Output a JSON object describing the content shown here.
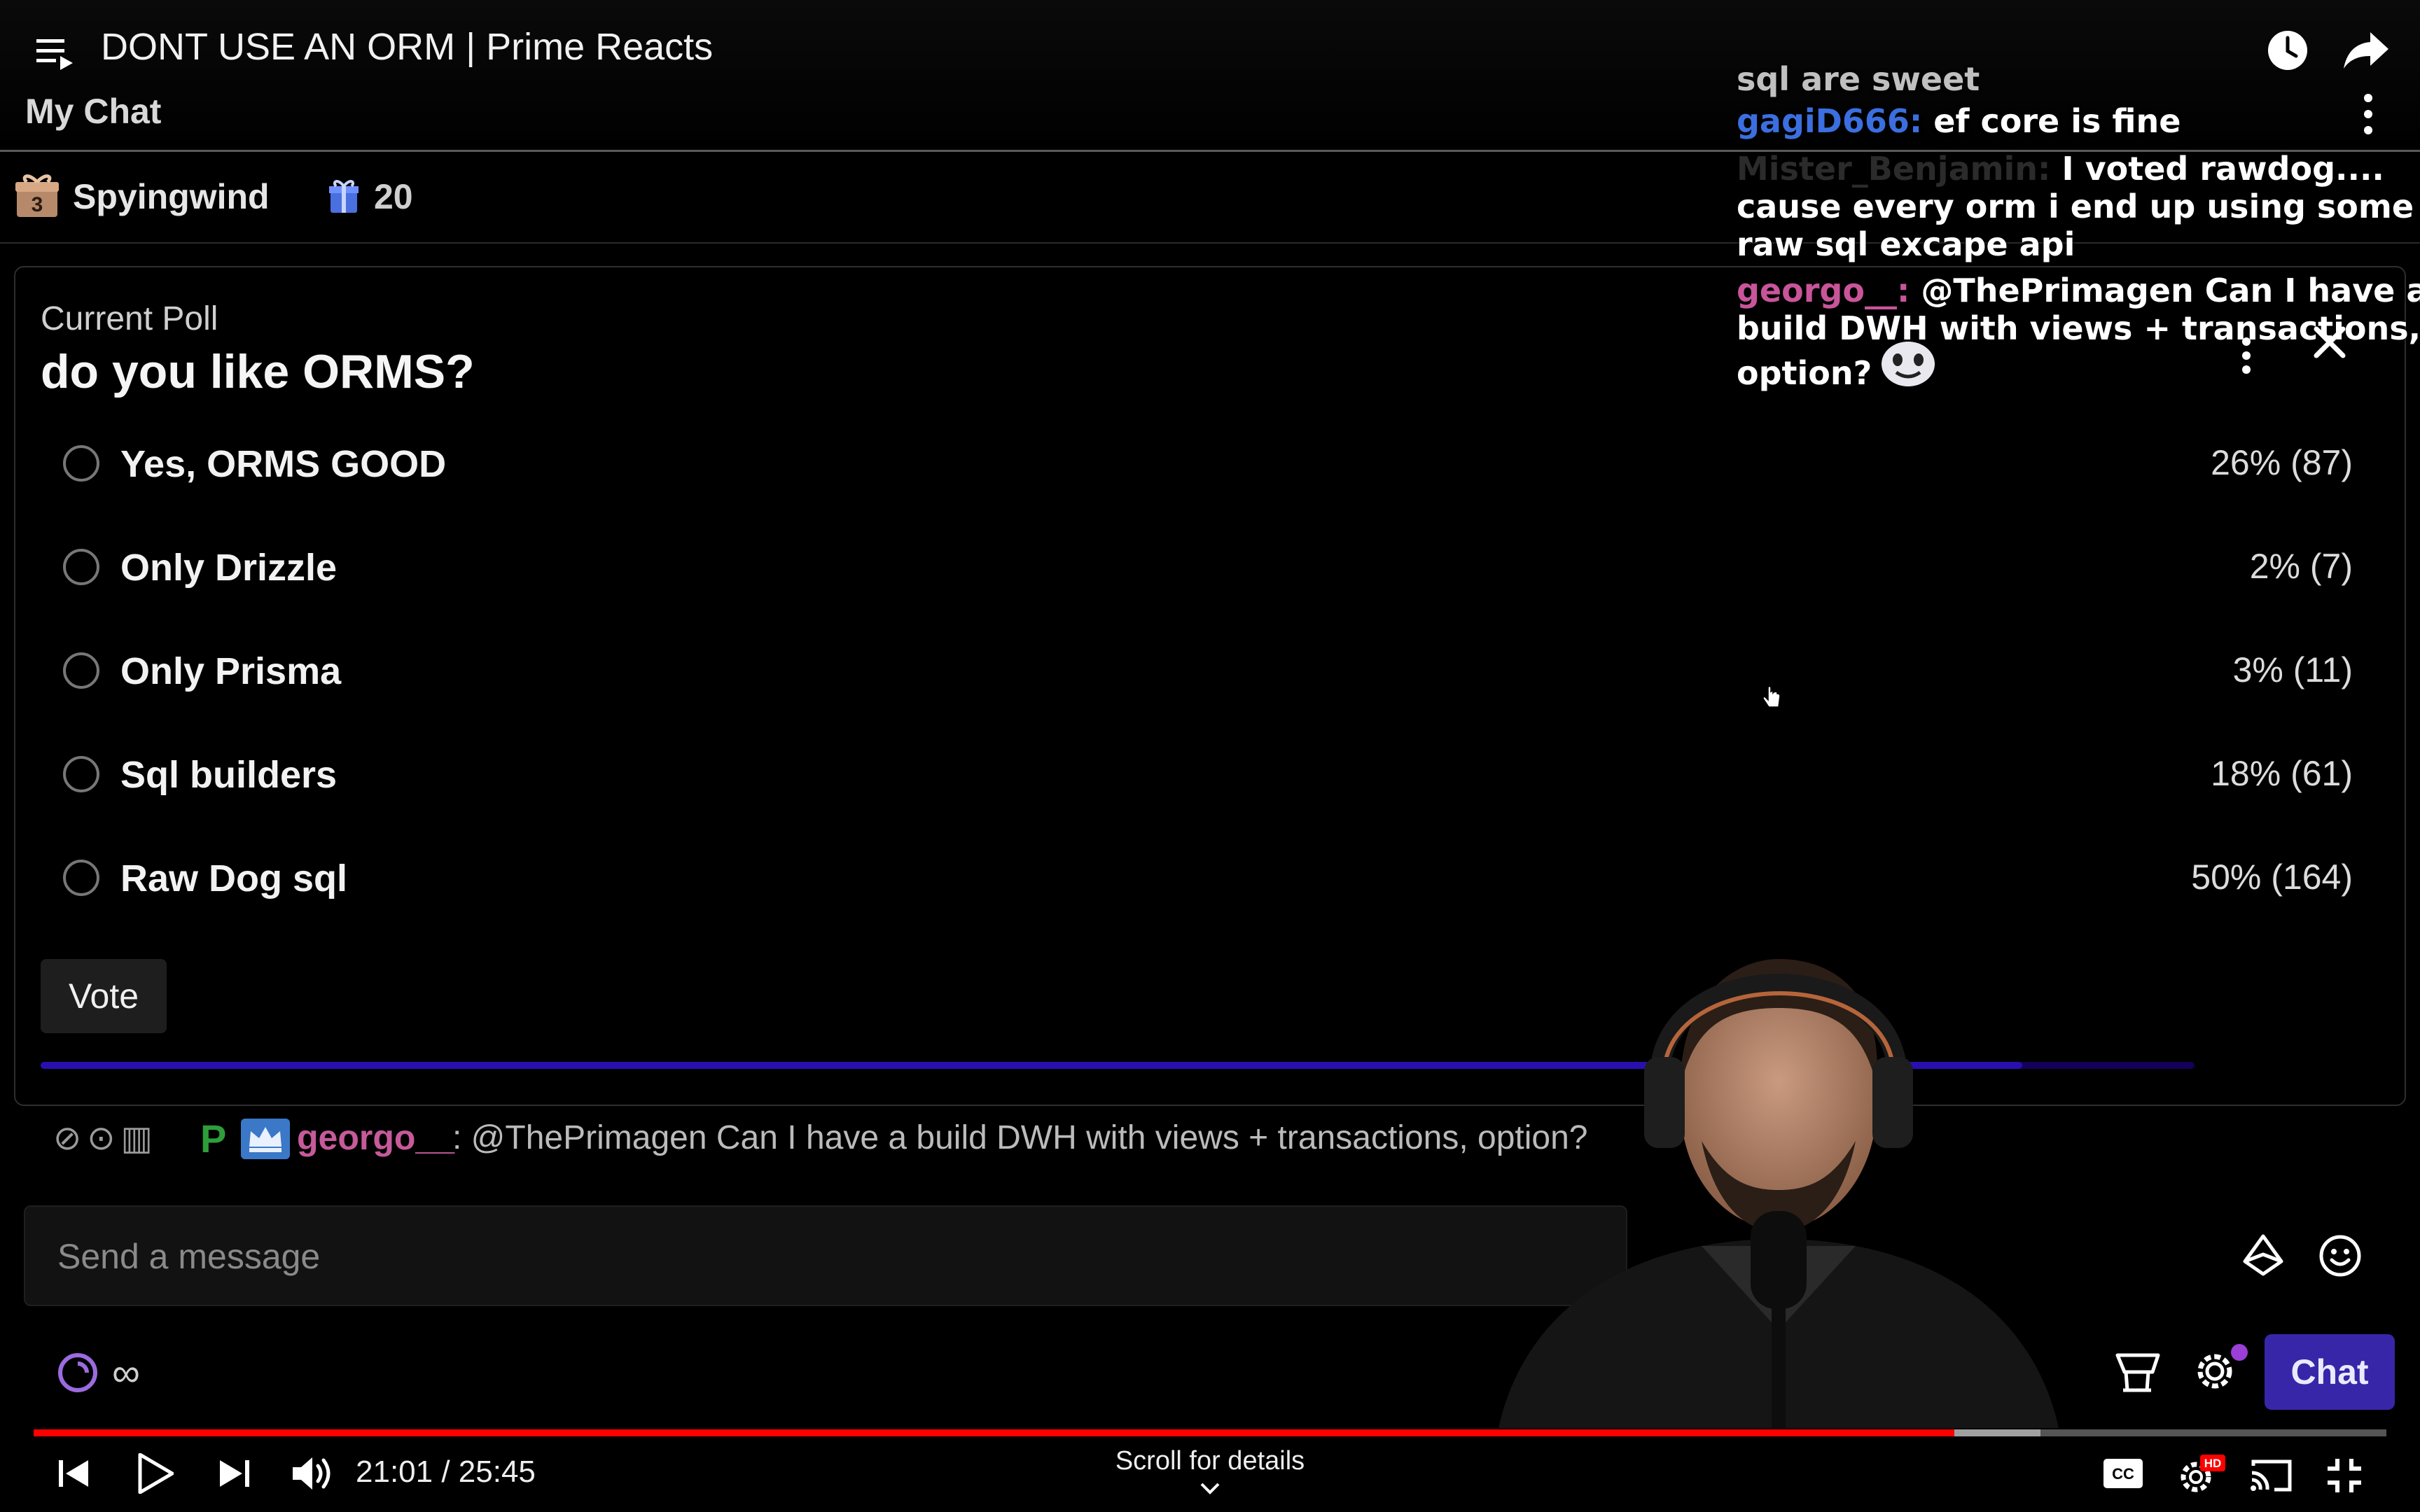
{
  "header": {
    "title": "DONT USE AN ORM | Prime Reacts",
    "chat_title": "My Chat"
  },
  "gift": {
    "badge_count": "3",
    "gifter": "Spyingwind",
    "count": "20"
  },
  "poll": {
    "caption": "Current Poll",
    "question": "do you like ORMS?",
    "options": [
      {
        "label": "Yes, ORMS GOOD",
        "result": "26% (87)"
      },
      {
        "label": "Only Drizzle",
        "result": "2% (7)"
      },
      {
        "label": "Only Prisma",
        "result": "3% (11)"
      },
      {
        "label": "Sql builders",
        "result": "18% (61)"
      },
      {
        "label": "Raw Dog sql",
        "result": "50% (164)"
      }
    ],
    "vote_label": "Vote",
    "time_remaining_fraction": 0.92
  },
  "chat_message": {
    "user": "georgo__",
    "text": ": @ThePrimagen Can I have a build DWH with views + transactions, option?",
    "badge_letter": "P"
  },
  "input": {
    "placeholder": "Send a message"
  },
  "chat_tools": {
    "points_value": "∞",
    "chat_button": "Chat"
  },
  "overlay_chat": {
    "lines": [
      {
        "user": "",
        "text": "sql are sweet"
      },
      {
        "user": "gagiD666:",
        "text": " ef core is fine"
      },
      {
        "user": "Mister_Benjamin:",
        "text": " I voted rawdog...."
      },
      {
        "user": "",
        "text": "cause every orm i end up using some"
      },
      {
        "user": "",
        "text": "raw sql excape api"
      },
      {
        "user": "georgo__:",
        "text": " @ThePrimagen Can I have a"
      },
      {
        "user": "",
        "text": "build DWH with views + transactions,"
      },
      {
        "user": "",
        "text": "option?"
      }
    ]
  },
  "player": {
    "time": "21:01 / 25:45",
    "scroll_hint": "Scroll for details",
    "progress_fraction": 0.8165,
    "buffer_fraction": 0.853,
    "hd_badge": "HD",
    "accent": "#ff0000"
  }
}
